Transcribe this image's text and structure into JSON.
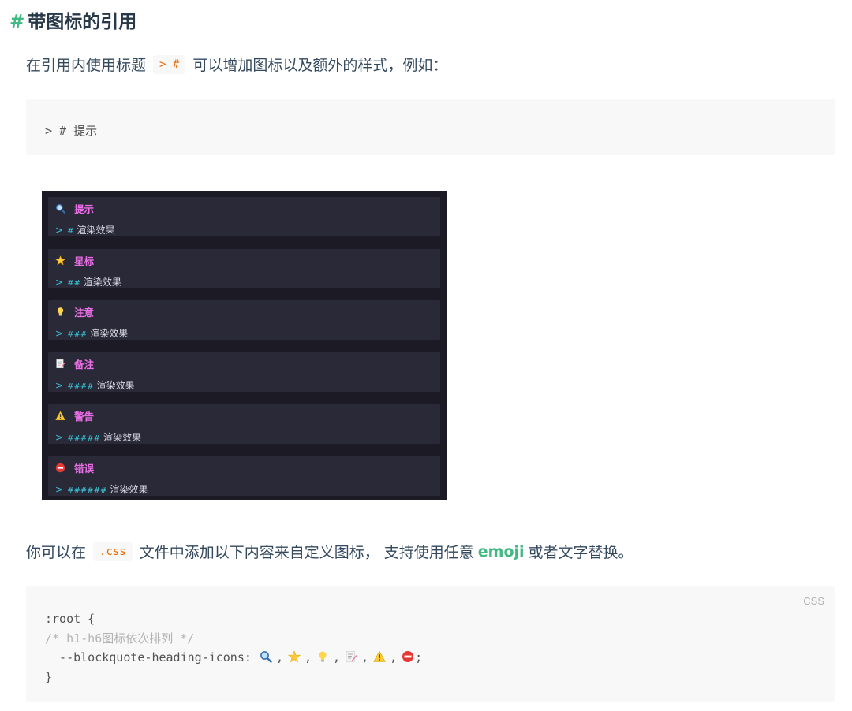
{
  "heading": {
    "hash": "#",
    "text": "带图标的引用"
  },
  "para1": {
    "before": "在引用内使用标题",
    "code": "> #",
    "after": "可以增加图标以及额外的样式，例如："
  },
  "code1": {
    "text": "> # 提示"
  },
  "preview": {
    "blocks": [
      {
        "icon": "magnifier-icon",
        "title": "提示",
        "hashes": "#",
        "body": "渲染效果"
      },
      {
        "icon": "star-icon",
        "title": "星标",
        "hashes": "##",
        "body": "渲染效果"
      },
      {
        "icon": "lightbulb-icon",
        "title": "注意",
        "hashes": "###",
        "body": "渲染效果"
      },
      {
        "icon": "memo-icon",
        "title": "备注",
        "hashes": "####",
        "body": "渲染效果"
      },
      {
        "icon": "warning-icon",
        "title": "警告",
        "hashes": "#####",
        "body": "渲染效果"
      },
      {
        "icon": "no-entry-icon",
        "title": "错误",
        "hashes": "######",
        "body": "渲染效果"
      }
    ],
    "arrow": ">"
  },
  "para2": {
    "before": "你可以在",
    "code": ".css",
    "middle": "文件中添加以下内容来自定义图标，  支持使用任意",
    "emoji": "emoji",
    "after": "或者文字替换。"
  },
  "code2": {
    "lang": "CSS",
    "line1": ":root {",
    "line2": "/* h1-h6图标依次排列 */",
    "line3_prefix": "  --blockquote-heading-icons: ",
    "line3_suffix": ";",
    "separator": ",",
    "icons": [
      "magnifier-icon",
      "star-icon",
      "lightbulb-icon",
      "memo-icon",
      "warning-icon",
      "no-entry-icon"
    ],
    "line4": "}"
  },
  "colors": {
    "accent": "#42b983",
    "code_orange": "#e96900",
    "preview_title": "#ea6fe6",
    "preview_cyan": "#38c6d8",
    "preview_bg": "#1c1b25"
  }
}
